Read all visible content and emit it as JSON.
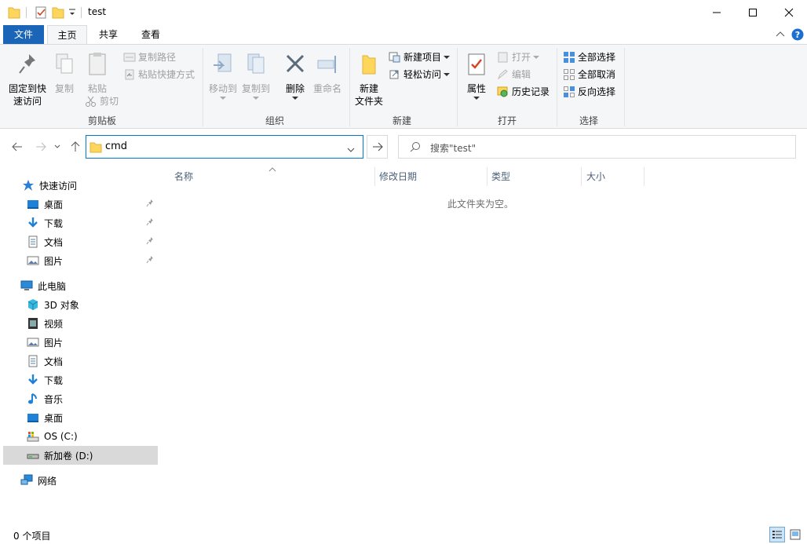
{
  "window": {
    "title": "test",
    "minimize_icon": "minimize-icon",
    "maximize_icon": "maximize-icon",
    "close_icon": "close-icon"
  },
  "ribbon_tabs": {
    "file": "文件",
    "home": "主页",
    "share": "共享",
    "view": "查看"
  },
  "ribbon": {
    "clipboard": {
      "group_label": "剪贴板",
      "pin_quick_access_line1": "固定到快",
      "pin_quick_access_line2": "速访问",
      "copy": "复制",
      "paste": "粘贴",
      "copy_path": "复制路径",
      "paste_shortcut": "粘贴快捷方式",
      "cut": "剪切"
    },
    "organize": {
      "group_label": "组织",
      "move_to": "移动到",
      "copy_to": "复制到",
      "delete": "删除",
      "rename": "重命名"
    },
    "new": {
      "group_label": "新建",
      "new_folder_line1": "新建",
      "new_folder_line2": "文件夹",
      "new_item": "新建项目",
      "easy_access": "轻松访问"
    },
    "open": {
      "group_label": "打开",
      "properties": "属性",
      "open": "打开",
      "edit": "编辑",
      "history": "历史记录"
    },
    "select": {
      "group_label": "选择",
      "select_all": "全部选择",
      "select_none": "全部取消",
      "invert_selection": "反向选择"
    }
  },
  "address_bar": {
    "value": "cmd",
    "search_placeholder": "搜索\"test\""
  },
  "nav_pane": {
    "quick_access": "快速访问",
    "qa_items": [
      {
        "label": "桌面",
        "icon": "desktop-icon"
      },
      {
        "label": "下载",
        "icon": "download-icon"
      },
      {
        "label": "文档",
        "icon": "document-icon"
      },
      {
        "label": "图片",
        "icon": "picture-icon"
      }
    ],
    "this_pc": "此电脑",
    "pc_items": [
      {
        "label": "3D 对象",
        "icon": "3d-objects-icon"
      },
      {
        "label": "视频",
        "icon": "video-icon"
      },
      {
        "label": "图片",
        "icon": "picture-icon"
      },
      {
        "label": "文档",
        "icon": "document-icon"
      },
      {
        "label": "下载",
        "icon": "download-icon"
      },
      {
        "label": "音乐",
        "icon": "music-icon"
      },
      {
        "label": "桌面",
        "icon": "desktop-icon"
      },
      {
        "label": "OS (C:)",
        "icon": "os-drive-icon"
      },
      {
        "label": "新加卷 (D:)",
        "icon": "drive-icon"
      }
    ],
    "network": "网络"
  },
  "columns": {
    "name": "名称",
    "date_modified": "修改日期",
    "type": "类型",
    "size": "大小"
  },
  "content": {
    "empty_message": "此文件夹为空。"
  },
  "status": {
    "item_count": "0 个项目"
  },
  "colors": {
    "file_tab": "#1a65b8",
    "ribbon_bg": "#f5f6f7",
    "address_border": "#0078d7",
    "selected_nav": "#d9d9d9",
    "help": "#1c6fd1"
  }
}
